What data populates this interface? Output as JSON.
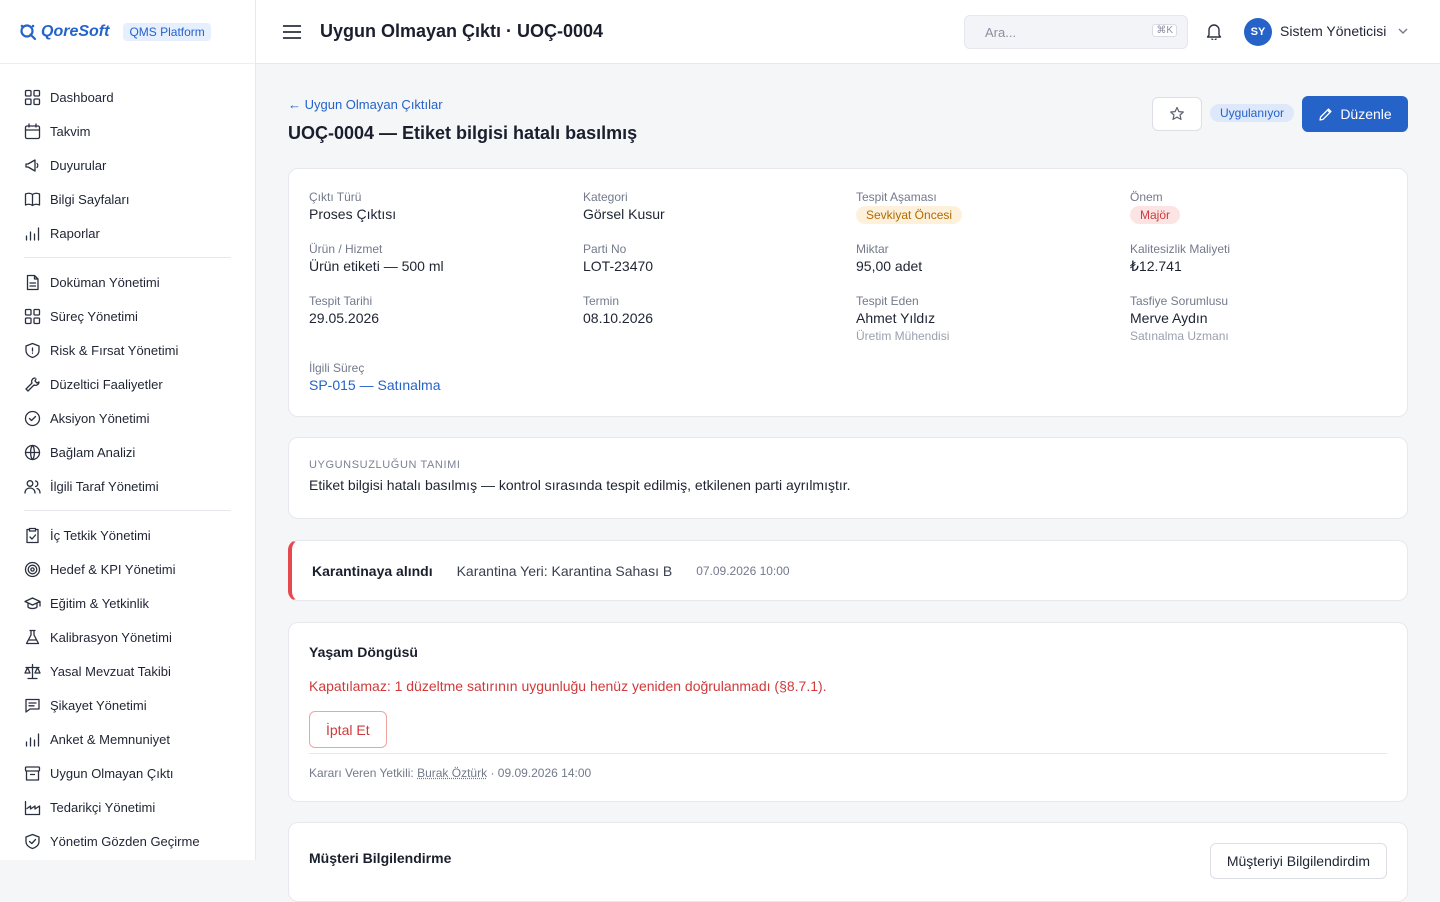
{
  "brand": {
    "name": "QoreSoft",
    "badge": "QMS Platform"
  },
  "sidebar": {
    "groups": [
      [
        {
          "label": "Dashboard",
          "icon": "dashboard-icon"
        },
        {
          "label": "Takvim",
          "icon": "calendar-icon"
        },
        {
          "label": "Duyurular",
          "icon": "megaphone-icon"
        },
        {
          "label": "Bilgi Sayfaları",
          "icon": "book-icon"
        },
        {
          "label": "Raporlar",
          "icon": "bar-chart-icon"
        }
      ],
      [
        {
          "label": "Doküman Yönetimi",
          "icon": "document-icon"
        },
        {
          "label": "Süreç Yönetimi",
          "icon": "grid-icon"
        },
        {
          "label": "Risk & Fırsat Yönetimi",
          "icon": "shield-icon"
        },
        {
          "label": "Düzeltici Faaliyetler",
          "icon": "wrench-icon"
        },
        {
          "label": "Aksiyon Yönetimi",
          "icon": "check-circle-icon"
        },
        {
          "label": "Bağlam Analizi",
          "icon": "globe-icon"
        },
        {
          "label": "İlgili Taraf Yönetimi",
          "icon": "users-icon"
        }
      ],
      [
        {
          "label": "İç Tetkik Yönetimi",
          "icon": "clipboard-check-icon"
        },
        {
          "label": "Hedef & KPI Yönetimi",
          "icon": "target-icon"
        },
        {
          "label": "Eğitim & Yetkinlik",
          "icon": "graduation-cap-icon"
        },
        {
          "label": "Kalibrasyon Yönetimi",
          "icon": "flask-icon"
        },
        {
          "label": "Yasal Mevzuat Takibi",
          "icon": "scale-icon"
        },
        {
          "label": "Şikayet Yönetimi",
          "icon": "message-icon"
        },
        {
          "label": "Anket & Memnuniyet",
          "icon": "bar-chart-icon"
        },
        {
          "label": "Uygun Olmayan Çıktı",
          "icon": "archive-icon"
        },
        {
          "label": "Tedarikçi Yönetimi",
          "icon": "factory-icon"
        },
        {
          "label": "Yönetim Gözden Geçirme",
          "icon": "shield-check-icon"
        }
      ]
    ]
  },
  "header": {
    "title": "Uygun Olmayan Çıktı · UOÇ-0004",
    "search_placeholder": "Ara...",
    "search_shortcut": "⌘K",
    "user_initials": "SY",
    "user_name": "Sistem Yöneticisi"
  },
  "record": {
    "back_label": "← Uygun Olmayan Çıktılar",
    "title": "UOÇ-0004 — Etiket bilgisi hatalı basılmış",
    "status": "Uygulanıyor",
    "edit_label": "Düzenle"
  },
  "fields": {
    "output_type": {
      "label": "Çıktı Türü",
      "value": "Proses Çıktısı"
    },
    "category": {
      "label": "Kategori",
      "value": "Görsel Kusur"
    },
    "detect_stage": {
      "label": "Tespit Aşaması",
      "value": "Sevkiyat Öncesi"
    },
    "severity": {
      "label": "Önem",
      "value": "Majör"
    },
    "product": {
      "label": "Ürün / Hizmet",
      "value": "Ürün etiketi — 500 ml"
    },
    "lot": {
      "label": "Parti No",
      "value": "LOT-23470"
    },
    "quantity": {
      "label": "Miktar",
      "value": "95,00 adet"
    },
    "cost": {
      "label": "Kalitesizlik Maliyeti",
      "value": "₺12.741"
    },
    "detect_date": {
      "label": "Tespit Tarihi",
      "value": "29.05.2026"
    },
    "deadline": {
      "label": "Termin",
      "value": "08.10.2026"
    },
    "detected_by": {
      "label": "Tespit Eden",
      "value": "Ahmet Yıldız",
      "role": "Üretim Mühendisi"
    },
    "disposition_owner": {
      "label": "Tasfiye Sorumlusu",
      "value": "Merve Aydın",
      "role": "Satınalma Uzmanı"
    },
    "process": {
      "label": "İlgili Süreç",
      "value": "SP-015 — Satınalma"
    }
  },
  "description": {
    "caption": "UYGUNSUZLUĞUN TANIMI",
    "text": "Etiket bilgisi hatalı basılmış — kontrol sırasında tespit edilmiş, etkilenen parti ayrılmıştır."
  },
  "quarantine": {
    "title": "Karantinaya alındı",
    "location": "Karantina Yeri: Karantina Sahası B",
    "date": "07.09.2026 10:00"
  },
  "lifecycle": {
    "title": "Yaşam Döngüsü",
    "warning": "Kapatılamaz: 1 düzeltme satırının uygunluğu henüz yeniden doğrulanmadı (§8.7.1).",
    "cancel_label": "İptal Et",
    "meta_prefix": "Kararı Veren Yetkili: ",
    "meta_person": "Burak Öztürk",
    "meta_date": " · 09.09.2026 14:00"
  },
  "customer": {
    "title": "Müşteri Bilgilendirme",
    "button_label": "Müşteriyi Bilgilendirdim"
  },
  "colors": {
    "accent": "#2563c9",
    "danger": "#d03a3a",
    "warning": "#b26a00"
  }
}
